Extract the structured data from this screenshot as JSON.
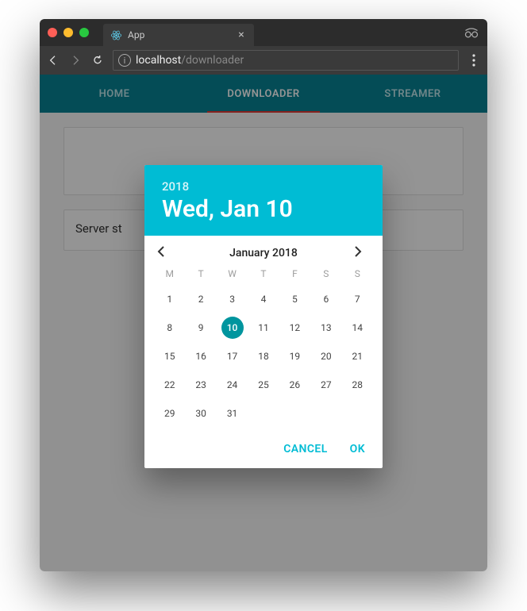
{
  "browser": {
    "tab_title": "App",
    "url_host": "localhost",
    "url_path": "/downloader"
  },
  "nav": {
    "tabs": [
      {
        "label": "HOME"
      },
      {
        "label": "DOWNLOADER"
      },
      {
        "label": "STREAMER"
      }
    ],
    "active_index": 1
  },
  "body": {
    "server_status_label": "Server st"
  },
  "datepicker": {
    "year": "2018",
    "date_display": "Wed, Jan 10",
    "month_label": "January 2018",
    "weekday_headers": [
      "M",
      "T",
      "W",
      "T",
      "F",
      "S",
      "S"
    ],
    "days": [
      1,
      2,
      3,
      4,
      5,
      6,
      7,
      8,
      9,
      10,
      11,
      12,
      13,
      14,
      15,
      16,
      17,
      18,
      19,
      20,
      21,
      22,
      23,
      24,
      25,
      26,
      27,
      28,
      29,
      30,
      31
    ],
    "selected_day": 10,
    "actions": {
      "cancel": "CANCEL",
      "ok": "OK"
    }
  }
}
